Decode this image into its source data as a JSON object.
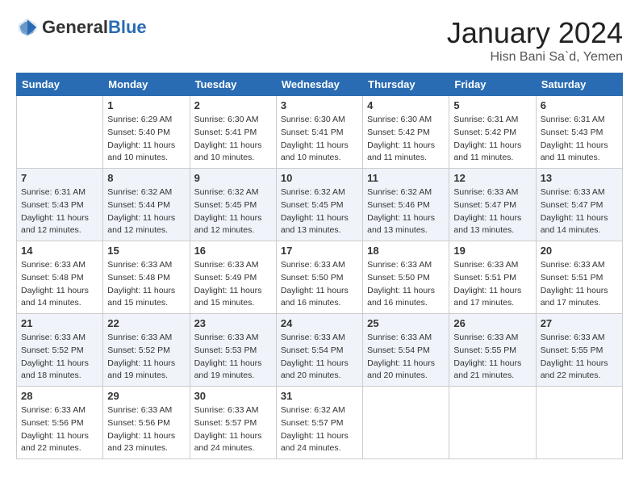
{
  "header": {
    "logo_general": "General",
    "logo_blue": "Blue",
    "month": "January 2024",
    "location": "Hisn Bani Sa`d, Yemen"
  },
  "days_of_week": [
    "Sunday",
    "Monday",
    "Tuesday",
    "Wednesday",
    "Thursday",
    "Friday",
    "Saturday"
  ],
  "weeks": [
    [
      {
        "day": "",
        "info": ""
      },
      {
        "day": "1",
        "info": "Sunrise: 6:29 AM\nSunset: 5:40 PM\nDaylight: 11 hours\nand 10 minutes."
      },
      {
        "day": "2",
        "info": "Sunrise: 6:30 AM\nSunset: 5:41 PM\nDaylight: 11 hours\nand 10 minutes."
      },
      {
        "day": "3",
        "info": "Sunrise: 6:30 AM\nSunset: 5:41 PM\nDaylight: 11 hours\nand 10 minutes."
      },
      {
        "day": "4",
        "info": "Sunrise: 6:30 AM\nSunset: 5:42 PM\nDaylight: 11 hours\nand 11 minutes."
      },
      {
        "day": "5",
        "info": "Sunrise: 6:31 AM\nSunset: 5:42 PM\nDaylight: 11 hours\nand 11 minutes."
      },
      {
        "day": "6",
        "info": "Sunrise: 6:31 AM\nSunset: 5:43 PM\nDaylight: 11 hours\nand 11 minutes."
      }
    ],
    [
      {
        "day": "7",
        "info": "Sunrise: 6:31 AM\nSunset: 5:43 PM\nDaylight: 11 hours\nand 12 minutes."
      },
      {
        "day": "8",
        "info": "Sunrise: 6:32 AM\nSunset: 5:44 PM\nDaylight: 11 hours\nand 12 minutes."
      },
      {
        "day": "9",
        "info": "Sunrise: 6:32 AM\nSunset: 5:45 PM\nDaylight: 11 hours\nand 12 minutes."
      },
      {
        "day": "10",
        "info": "Sunrise: 6:32 AM\nSunset: 5:45 PM\nDaylight: 11 hours\nand 13 minutes."
      },
      {
        "day": "11",
        "info": "Sunrise: 6:32 AM\nSunset: 5:46 PM\nDaylight: 11 hours\nand 13 minutes."
      },
      {
        "day": "12",
        "info": "Sunrise: 6:33 AM\nSunset: 5:47 PM\nDaylight: 11 hours\nand 13 minutes."
      },
      {
        "day": "13",
        "info": "Sunrise: 6:33 AM\nSunset: 5:47 PM\nDaylight: 11 hours\nand 14 minutes."
      }
    ],
    [
      {
        "day": "14",
        "info": "Sunrise: 6:33 AM\nSunset: 5:48 PM\nDaylight: 11 hours\nand 14 minutes."
      },
      {
        "day": "15",
        "info": "Sunrise: 6:33 AM\nSunset: 5:48 PM\nDaylight: 11 hours\nand 15 minutes."
      },
      {
        "day": "16",
        "info": "Sunrise: 6:33 AM\nSunset: 5:49 PM\nDaylight: 11 hours\nand 15 minutes."
      },
      {
        "day": "17",
        "info": "Sunrise: 6:33 AM\nSunset: 5:50 PM\nDaylight: 11 hours\nand 16 minutes."
      },
      {
        "day": "18",
        "info": "Sunrise: 6:33 AM\nSunset: 5:50 PM\nDaylight: 11 hours\nand 16 minutes."
      },
      {
        "day": "19",
        "info": "Sunrise: 6:33 AM\nSunset: 5:51 PM\nDaylight: 11 hours\nand 17 minutes."
      },
      {
        "day": "20",
        "info": "Sunrise: 6:33 AM\nSunset: 5:51 PM\nDaylight: 11 hours\nand 17 minutes."
      }
    ],
    [
      {
        "day": "21",
        "info": "Sunrise: 6:33 AM\nSunset: 5:52 PM\nDaylight: 11 hours\nand 18 minutes."
      },
      {
        "day": "22",
        "info": "Sunrise: 6:33 AM\nSunset: 5:52 PM\nDaylight: 11 hours\nand 19 minutes."
      },
      {
        "day": "23",
        "info": "Sunrise: 6:33 AM\nSunset: 5:53 PM\nDaylight: 11 hours\nand 19 minutes."
      },
      {
        "day": "24",
        "info": "Sunrise: 6:33 AM\nSunset: 5:54 PM\nDaylight: 11 hours\nand 20 minutes."
      },
      {
        "day": "25",
        "info": "Sunrise: 6:33 AM\nSunset: 5:54 PM\nDaylight: 11 hours\nand 20 minutes."
      },
      {
        "day": "26",
        "info": "Sunrise: 6:33 AM\nSunset: 5:55 PM\nDaylight: 11 hours\nand 21 minutes."
      },
      {
        "day": "27",
        "info": "Sunrise: 6:33 AM\nSunset: 5:55 PM\nDaylight: 11 hours\nand 22 minutes."
      }
    ],
    [
      {
        "day": "28",
        "info": "Sunrise: 6:33 AM\nSunset: 5:56 PM\nDaylight: 11 hours\nand 22 minutes."
      },
      {
        "day": "29",
        "info": "Sunrise: 6:33 AM\nSunset: 5:56 PM\nDaylight: 11 hours\nand 23 minutes."
      },
      {
        "day": "30",
        "info": "Sunrise: 6:33 AM\nSunset: 5:57 PM\nDaylight: 11 hours\nand 24 minutes."
      },
      {
        "day": "31",
        "info": "Sunrise: 6:32 AM\nSunset: 5:57 PM\nDaylight: 11 hours\nand 24 minutes."
      },
      {
        "day": "",
        "info": ""
      },
      {
        "day": "",
        "info": ""
      },
      {
        "day": "",
        "info": ""
      }
    ]
  ]
}
